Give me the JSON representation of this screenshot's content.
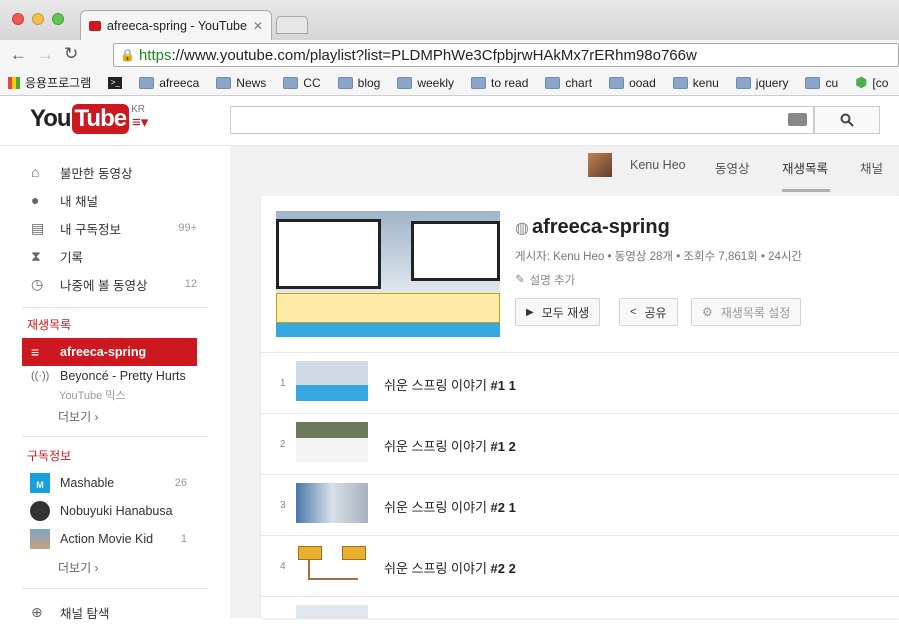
{
  "browser": {
    "tab_title": "afreeca-spring - YouTube",
    "url_https": "https",
    "url_rest": "://www.youtube.com/playlist?list=PLDMPhWe3CfpbjrwHAkMx7rERhm98o766w",
    "bookmarks": [
      "응용프로그램",
      "",
      "afreeca",
      "News",
      "CC",
      "blog",
      "weekly",
      "to read",
      "chart",
      "ooad",
      "kenu",
      "jquery",
      "cu",
      "[co"
    ]
  },
  "header": {
    "logo_you": "You",
    "logo_tube": "Tube",
    "logo_region": "KR"
  },
  "sidebar": {
    "items": [
      {
        "label": "불만한 동영상",
        "icon": "home-icon",
        "count": ""
      },
      {
        "label": "내 채널",
        "icon": "user-icon",
        "count": ""
      },
      {
        "label": "내 구독정보",
        "icon": "subscriptions-icon",
        "count": "99+"
      },
      {
        "label": "기록",
        "icon": "hourglass-icon",
        "count": ""
      },
      {
        "label": "나중에 볼 동영상",
        "icon": "clock-icon",
        "count": "12"
      }
    ],
    "playlists_heading": "재생목록",
    "playlists": [
      {
        "label": "afreeca-spring"
      },
      {
        "label": "Beyoncé - Pretty Hurts",
        "sub": "YouTube 믹스"
      }
    ],
    "more1": "더보기 ›",
    "subscriptions_heading": "구독정보",
    "subscriptions": [
      {
        "label": "Mashable",
        "count": "26"
      },
      {
        "label": "Nobuyuki Hanabusa",
        "count": ""
      },
      {
        "label": "Action Movie Kid",
        "count": "1"
      }
    ],
    "more2": "더보기 ›",
    "browse": "채널 탐색"
  },
  "channel_tabs": {
    "name": "Kenu Heo",
    "tabs": [
      "동영상",
      "재생목록",
      "채널"
    ]
  },
  "playlist": {
    "title": "afreeca-spring",
    "meta": "게시자: Kenu Heo • 동영상 28개 • 조회수 7,861회 • 24시간",
    "add_description": "설명 추가",
    "play_all": "모두 재생",
    "share": "공유",
    "settings": "재생목록 설정"
  },
  "videos": [
    {
      "num": "1",
      "title": "쉬운 스프링 이야기 ",
      "bold": "#1 1"
    },
    {
      "num": "2",
      "title": "쉬운 스프링 이야기 ",
      "bold": "#1 2"
    },
    {
      "num": "3",
      "title": "쉬운 스프링 이야기 ",
      "bold": "#2 1"
    },
    {
      "num": "4",
      "title": "쉬운 스프링 이야기 ",
      "bold": "#2 2"
    }
  ]
}
